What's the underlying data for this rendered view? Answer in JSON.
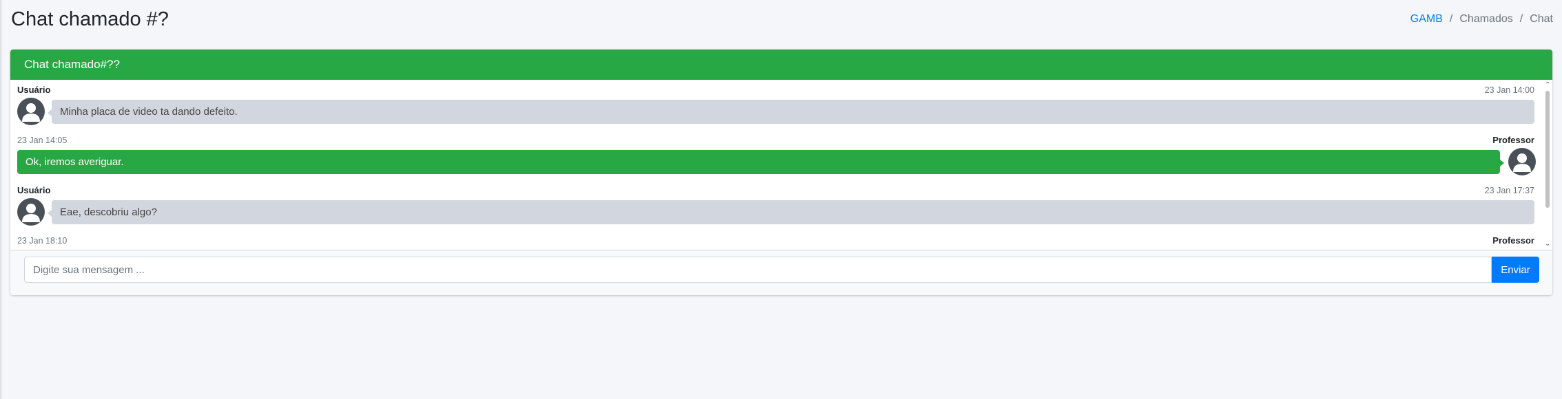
{
  "page": {
    "title": "Chat chamado #?",
    "breadcrumb": [
      "GAMB",
      "Chamados",
      "Chat"
    ]
  },
  "card": {
    "header_title": "Chat chamado#??"
  },
  "messages": [
    {
      "side": "left",
      "name": "Usuário",
      "time": "23 Jan 14:00",
      "text": "Minha placa de video ta dando defeito."
    },
    {
      "side": "right",
      "name": "Professor",
      "time": "23 Jan 14:05",
      "text": "Ok, iremos averiguar."
    },
    {
      "side": "left",
      "name": "Usuário",
      "time": "23 Jan 17:37",
      "text": "Eae, descobriu algo?"
    },
    {
      "side": "right",
      "name": "Professor",
      "time": "23 Jan 18:10",
      "text": ""
    }
  ],
  "composer": {
    "placeholder": "Digite sua mensagem ...",
    "send_label": "Enviar"
  },
  "colors": {
    "header": "#28a745",
    "user_bubble": "#d2d6de",
    "professor_bubble": "#28a745",
    "send_button": "#007bff",
    "link": "#007bff"
  },
  "icons": {
    "avatar": "user-avatar-icon",
    "scroll_up": "chevron-up-icon",
    "scroll_down": "chevron-down-icon"
  }
}
